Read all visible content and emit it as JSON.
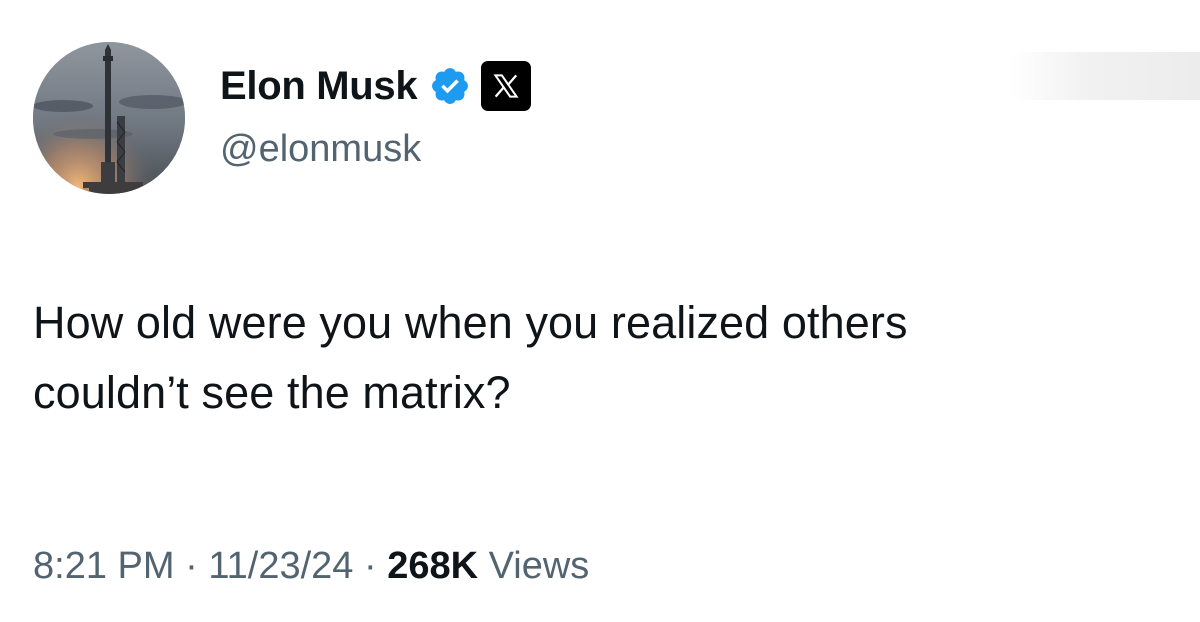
{
  "author": {
    "display_name": "Elon Musk",
    "handle": "@elonmusk",
    "verified_icon": "verified-badge-icon",
    "affiliate_icon": "x-logo-icon",
    "verified_color": "#1d9bf0"
  },
  "tweet": {
    "lines": [
      "How old were you when you realized others",
      "couldn’t see the matrix?"
    ]
  },
  "meta": {
    "time": "8:21 PM",
    "separator": "·",
    "date": "11/23/24",
    "views_count": "268K",
    "views_label": "Views"
  },
  "colors": {
    "text_primary": "#0f1419",
    "text_secondary": "#536471",
    "background": "#ffffff"
  }
}
